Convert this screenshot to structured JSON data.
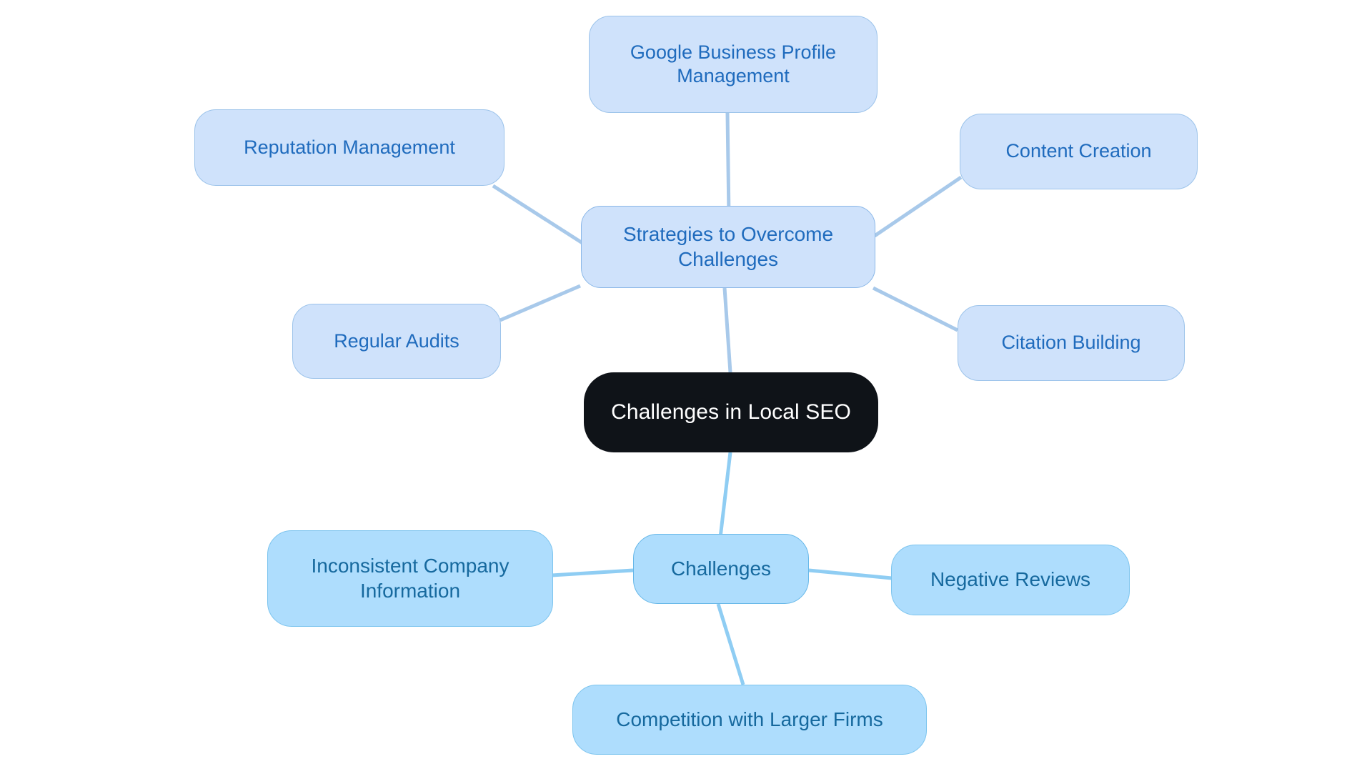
{
  "diagram": {
    "type": "mindmap",
    "title": "Challenges in Local SEO",
    "background": "#ffffff",
    "colors": {
      "root_fill": "#0f1318",
      "root_text": "#ffffff",
      "strategies_fill": "#cfe2fb",
      "strategies_border": "#9cc3ea",
      "strategies_text": "#1f6bbd",
      "challenges_fill": "#aeddfd",
      "challenges_border": "#7cc4ee",
      "challenges_text": "#16699e",
      "edge_strategies": "#a8c9ea",
      "edge_challenges": "#8fcdf3"
    }
  },
  "nodes": {
    "root": {
      "label": "Challenges in Local SEO"
    },
    "branch_strategies": {
      "label": "Strategies to Overcome\nChallenges"
    },
    "branch_challenges": {
      "label": "Challenges"
    },
    "strategy_leaves": [
      {
        "label": "Google Business Profile\nManagement"
      },
      {
        "label": "Reputation Management"
      },
      {
        "label": "Content Creation"
      },
      {
        "label": "Regular Audits"
      },
      {
        "label": "Citation Building"
      }
    ],
    "challenge_leaves": [
      {
        "label": "Inconsistent Company\nInformation"
      },
      {
        "label": "Negative Reviews"
      },
      {
        "label": "Competition with Larger Firms"
      }
    ]
  },
  "chart_data": {
    "type": "mindmap",
    "title": "Challenges in Local SEO",
    "root": "Challenges in Local SEO",
    "branches": [
      {
        "name": "Strategies to Overcome Challenges",
        "children": [
          "Google Business Profile Management",
          "Reputation Management",
          "Content Creation",
          "Regular Audits",
          "Citation Building"
        ]
      },
      {
        "name": "Challenges",
        "children": [
          "Inconsistent Company Information",
          "Negative Reviews",
          "Competition with Larger Firms"
        ]
      }
    ],
    "edges": [
      [
        "Challenges in Local SEO",
        "Strategies to Overcome Challenges"
      ],
      [
        "Challenges in Local SEO",
        "Challenges"
      ],
      [
        "Strategies to Overcome Challenges",
        "Google Business Profile Management"
      ],
      [
        "Strategies to Overcome Challenges",
        "Reputation Management"
      ],
      [
        "Strategies to Overcome Challenges",
        "Content Creation"
      ],
      [
        "Strategies to Overcome Challenges",
        "Regular Audits"
      ],
      [
        "Strategies to Overcome Challenges",
        "Citation Building"
      ],
      [
        "Challenges",
        "Inconsistent Company Information"
      ],
      [
        "Challenges",
        "Negative Reviews"
      ],
      [
        "Challenges",
        "Competition with Larger Firms"
      ]
    ]
  }
}
